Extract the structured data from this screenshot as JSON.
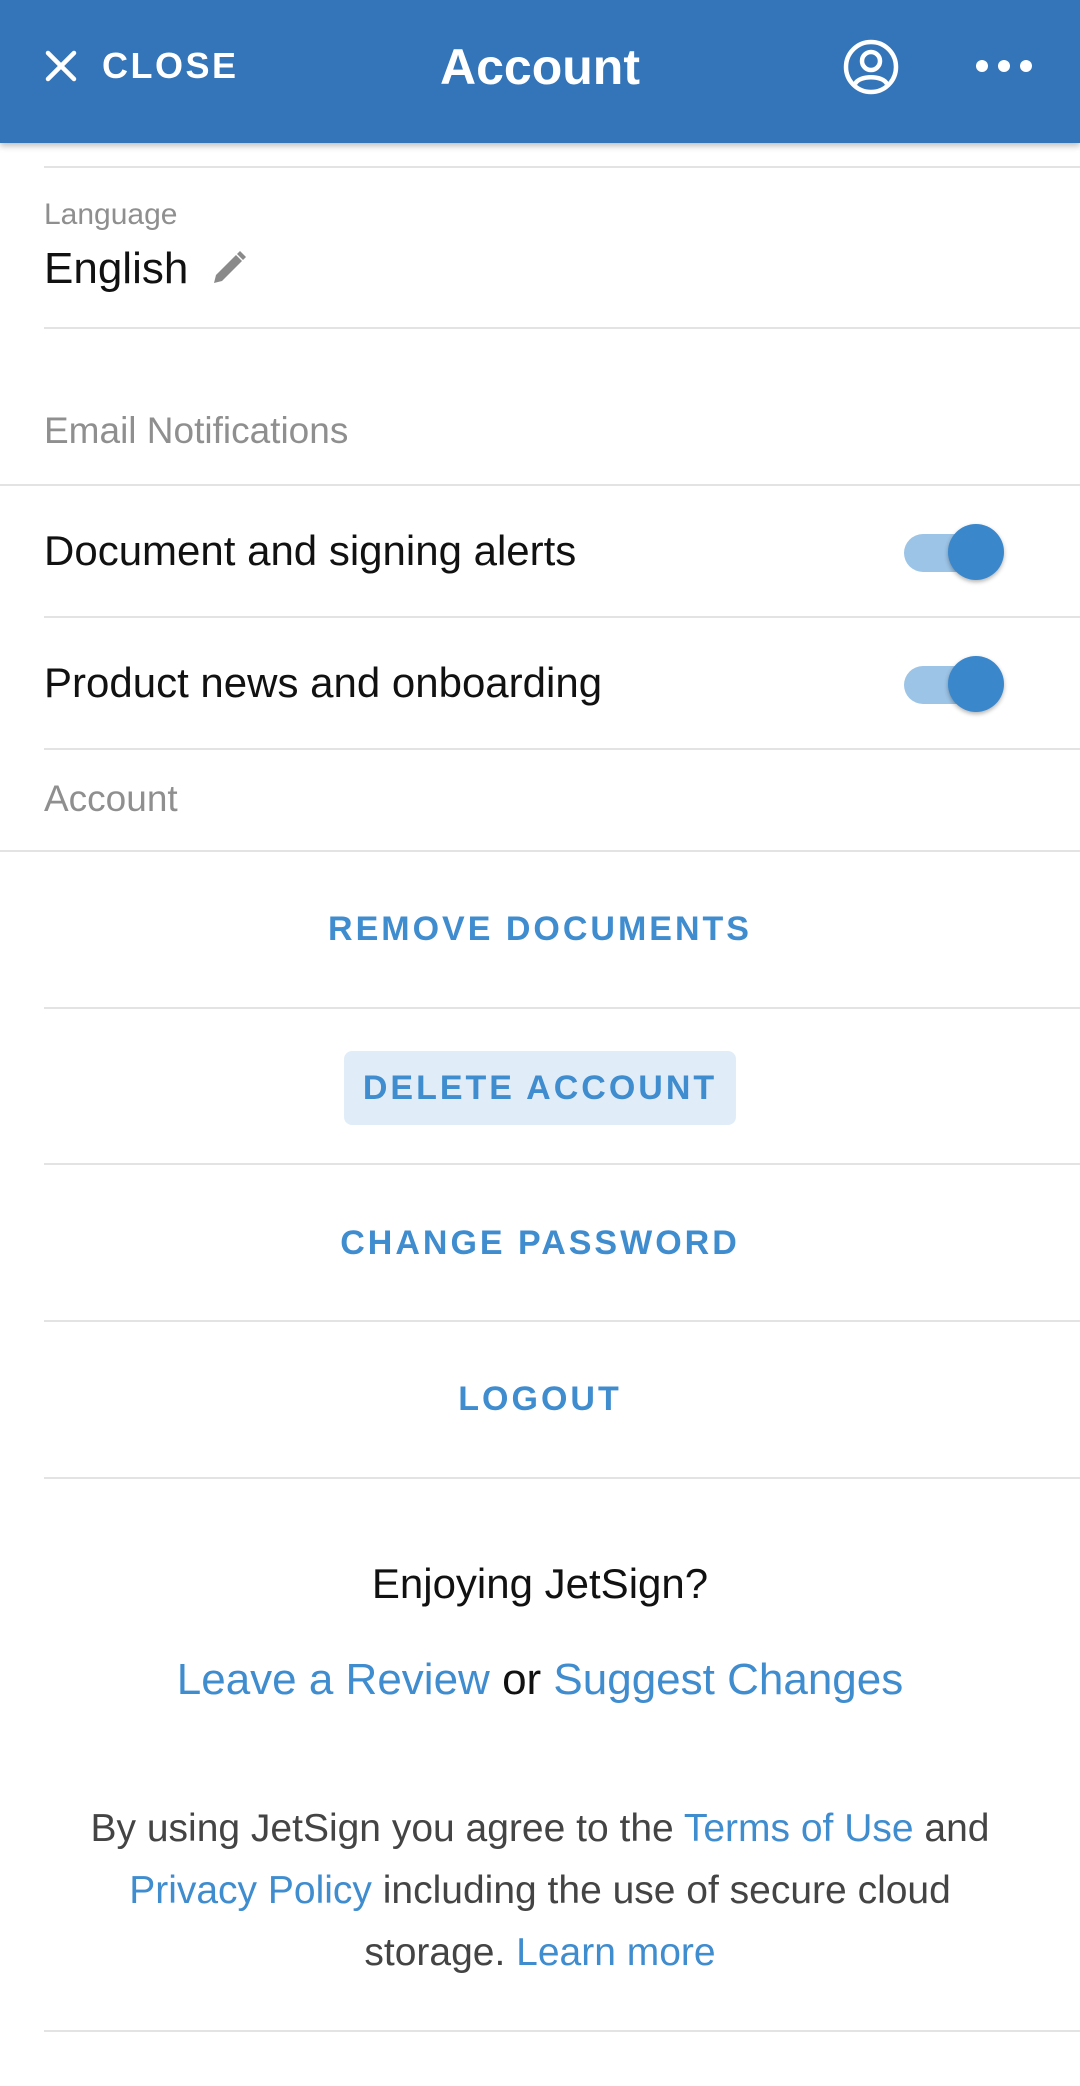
{
  "header": {
    "close_label": "CLOSE",
    "title": "Account",
    "icons": {
      "close": "close-icon",
      "profile": "account-circle-icon",
      "more": "more-horizontal-icon"
    },
    "background": "#3474b8"
  },
  "language": {
    "label": "Language",
    "value": "English",
    "edit_icon": "pencil-icon"
  },
  "email_notifications": {
    "section_label": "Email Notifications",
    "items": [
      {
        "label": "Document and signing alerts",
        "enabled": true
      },
      {
        "label": "Product news and onboarding",
        "enabled": true
      }
    ]
  },
  "account": {
    "section_label": "Account",
    "remove_documents": "REMOVE DOCUMENTS",
    "delete_account": "DELETE ACCOUNT",
    "change_password": "CHANGE PASSWORD",
    "logout": "LOGOUT"
  },
  "feedback": {
    "question": "Enjoying JetSign?",
    "leave_review": "Leave a Review",
    "or": "or",
    "suggest_changes": "Suggest Changes"
  },
  "legal": {
    "part1": "By using JetSign you agree to the",
    "terms_link": "Terms of Use",
    "and": "and",
    "privacy_link": "Privacy Policy",
    "part2": "including the use of secure cloud storage.",
    "learn_more": "Learn more"
  },
  "colors": {
    "accent": "#3f8ccf",
    "toggle_on": "#3b87cc",
    "toggle_track": "#9cc4e6"
  }
}
